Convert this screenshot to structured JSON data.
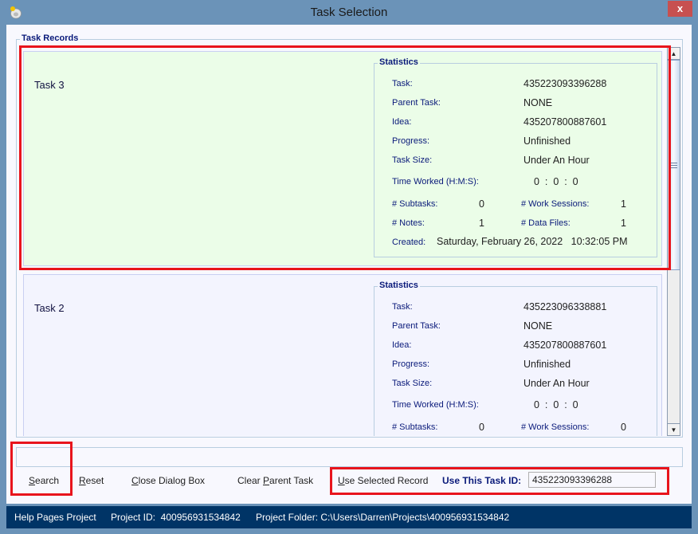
{
  "window": {
    "title": "Task Selection",
    "close_label": "x"
  },
  "task_records": {
    "legend": "Task Records",
    "records": [
      {
        "title": "Task 3",
        "selected": true,
        "stats_legend": "Statistics",
        "labels": {
          "task": "Task:",
          "parent_task": "Parent Task:",
          "idea": "Idea:",
          "progress": "Progress:",
          "task_size": "Task Size:",
          "time_worked": "Time Worked (H:M:S):",
          "subtasks": "# Subtasks:",
          "work_sessions": "# Work Sessions:",
          "notes": "# Notes:",
          "data_files": "# Data Files:",
          "created": "Created:"
        },
        "task": "435223093396288",
        "parent_task": "NONE",
        "idea": "435207800887601",
        "progress": "Unfinished",
        "task_size": "Under An Hour",
        "time_worked": "0  :  0  :  0",
        "subtasks": "0",
        "work_sessions": "1",
        "notes": "1",
        "data_files": "1",
        "created": "Saturday, February 26, 2022   10:32:05 PM"
      },
      {
        "title": "Task 2",
        "selected": false,
        "stats_legend": "Statistics",
        "labels": {
          "task": "Task:",
          "parent_task": "Parent Task:",
          "idea": "Idea:",
          "progress": "Progress:",
          "task_size": "Task Size:",
          "time_worked": "Time Worked (H:M:S):",
          "subtasks": "# Subtasks:",
          "work_sessions": "# Work Sessions:"
        },
        "task": "435223096338881",
        "parent_task": "NONE",
        "idea": "435207800887601",
        "progress": "Unfinished",
        "task_size": "Under An Hour",
        "time_worked": "0  :  0  :  0",
        "subtasks": "0",
        "work_sessions": "0"
      }
    ]
  },
  "search": {
    "value": ""
  },
  "buttons": {
    "search": {
      "mnemonic": "S",
      "rest": "earch"
    },
    "reset": {
      "mnemonic": "R",
      "rest": "eset"
    },
    "close": {
      "mnemonic": "C",
      "rest": "lose Dialog Box"
    },
    "clear_parent": {
      "pre": "Clear ",
      "mnemonic": "P",
      "rest": "arent Task"
    },
    "use_selected": {
      "mnemonic": "U",
      "rest": "se Selected Record"
    }
  },
  "use_task_id": {
    "label": "Use This Task ID:",
    "value": "435223093396288"
  },
  "statusbar": {
    "project_name": "Help Pages Project",
    "project_id": "Project ID:  400956931534842",
    "project_folder": "Project Folder: C:\\Users\\Darren\\Projects\\400956931534842"
  },
  "colors": {
    "highlight": "#e8141c",
    "selected_record_bg": "#ebfde8",
    "record_bg": "#f3f4fe",
    "label_color": "#0a1a7a",
    "statusbar_bg": "#003466",
    "titlebar_bg": "#6b93b8",
    "close_button_bg": "#c75050"
  }
}
